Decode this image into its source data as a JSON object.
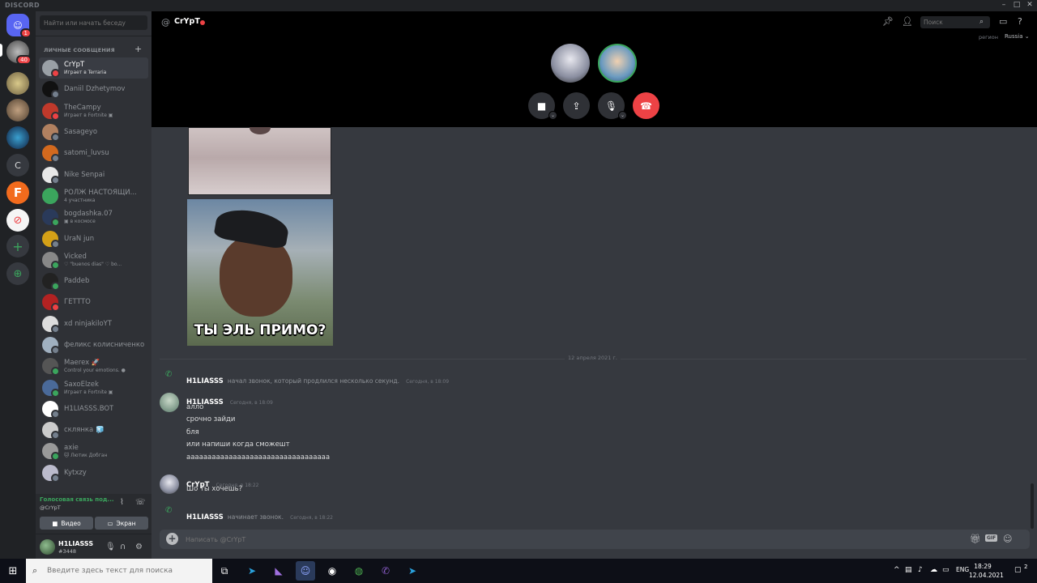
{
  "app": {
    "brand": "DISCORD"
  },
  "guilds": {
    "home_badge": "1",
    "second_badge": "40",
    "letter_server": "C",
    "f_server": "F",
    "add_server": "+",
    "explore": "⊕"
  },
  "dm_sidebar": {
    "search_placeholder": "Найти или начать беседу",
    "header": "ЛИЧНЫЕ СООБЩЕНИЯ",
    "add": "+",
    "items": [
      {
        "name": "CrYpT",
        "sub": "Играет в Terraria",
        "color": "#9aa0a6",
        "status": "#ed4245"
      },
      {
        "name": "Daniil Dzhetymov",
        "sub": "",
        "color": "#111111",
        "status": "#747f8d"
      },
      {
        "name": "TheCampy",
        "sub": "Играет в Fortnite ▣",
        "color": "#c0392b",
        "status": "#ed4245"
      },
      {
        "name": "Sasageyo",
        "sub": "",
        "color": "#b08060",
        "status": "#747f8d"
      },
      {
        "name": "satomi_luvsu",
        "sub": "",
        "color": "#d2691e",
        "status": "#747f8d"
      },
      {
        "name": "Nike Senpai",
        "sub": "",
        "color": "#e8e8e8",
        "status": "#747f8d"
      },
      {
        "name": "РОЛЖ НАСТОЯЩИ...",
        "sub": "4 участника",
        "color": "#3ba55d",
        "status": ""
      },
      {
        "name": "bogdashka.07",
        "sub": "▣ в космосе",
        "color": "#2a3a5a",
        "status": "#3ba55d"
      },
      {
        "name": "UraN jun",
        "sub": "",
        "color": "#d4a017",
        "status": "#747f8d"
      },
      {
        "name": "Vicked",
        "sub": "♡  \"buenos dias\"  ♡ bo...",
        "color": "#888888",
        "status": "#3ba55d"
      },
      {
        "name": "Paddeb",
        "sub": "",
        "color": "#222222",
        "status": "#3ba55d"
      },
      {
        "name": "ГЕТТТО",
        "sub": "",
        "color": "#b22222",
        "status": "#ed4245"
      },
      {
        "name": "xd ninjakiloYT",
        "sub": "",
        "color": "#dddddd",
        "status": "#747f8d"
      },
      {
        "name": "феликс колисниченко",
        "sub": "",
        "color": "#a0b0c0",
        "status": "#747f8d"
      },
      {
        "name": "Maerex 🚀",
        "sub": "Control your emotions. ●",
        "color": "#555555",
        "status": "#3ba55d"
      },
      {
        "name": "SaxoElzek",
        "sub": "Играет в Fortnite ▣",
        "color": "#4a6a9a",
        "status": "#3ba55d"
      },
      {
        "name": "H1LIASSS.BOT",
        "sub": "",
        "color": "#ffffff",
        "status": "#747f8d"
      },
      {
        "name": "склянка 🧊",
        "sub": "",
        "color": "#cccccc",
        "status": "#747f8d"
      },
      {
        "name": "axie",
        "sub": "🐱 Лютик Добган",
        "color": "#999999",
        "status": "#3ba55d"
      },
      {
        "name": "Kytxzy",
        "sub": "",
        "color": "#bbbbcc",
        "status": "#747f8d"
      }
    ]
  },
  "voice_panel": {
    "status": "Голосовая связь под...",
    "channel": "@CrYpT",
    "video_label": "Видео",
    "screen_label": "Экран"
  },
  "user_panel": {
    "name": "H1LIASSS",
    "tag": "#3448"
  },
  "call": {
    "at_icon": "@",
    "title": "CrYpT",
    "search_placeholder": "Поиск",
    "region_label": "регион",
    "region_value": "Russia ⌄"
  },
  "chat": {
    "image_caption": "ТЫ ЭЛЬ ПРИМО?",
    "date_divider": "12 апреля 2021 г.",
    "system1": {
      "author": "H1LIASSS",
      "text": "начал звонок, который продлился несколько секунд.",
      "time": "Сегодня, в 18:09"
    },
    "group1": {
      "author": "H1LIASSS",
      "time": "Сегодня, в 18:09",
      "lines": [
        "алло",
        "срочно зайди",
        "бля",
        "или напиши когда сможешт",
        "аааааааааааааааааааааааааааааааааа"
      ]
    },
    "group2": {
      "author": "CrYpT",
      "time": "Сегодня, в 18:22",
      "lines": [
        "Шо ты хочешь?"
      ]
    },
    "system2": {
      "author": "H1LIASSS",
      "text": "начинает звонок.",
      "time": "Сегодня, в 18:22"
    },
    "composer_placeholder": "Написать @CrYpT",
    "gif_label": "GIF"
  },
  "taskbar": {
    "search_placeholder": "Введите здесь текст для поиска",
    "lang": "ENG",
    "time": "18:29",
    "date": "12.04.2021",
    "notif_count": "2"
  },
  "colors": {
    "accent": "#5865f2",
    "online": "#3ba55d",
    "dnd": "#ed4245",
    "hangup": "#ed4245"
  }
}
